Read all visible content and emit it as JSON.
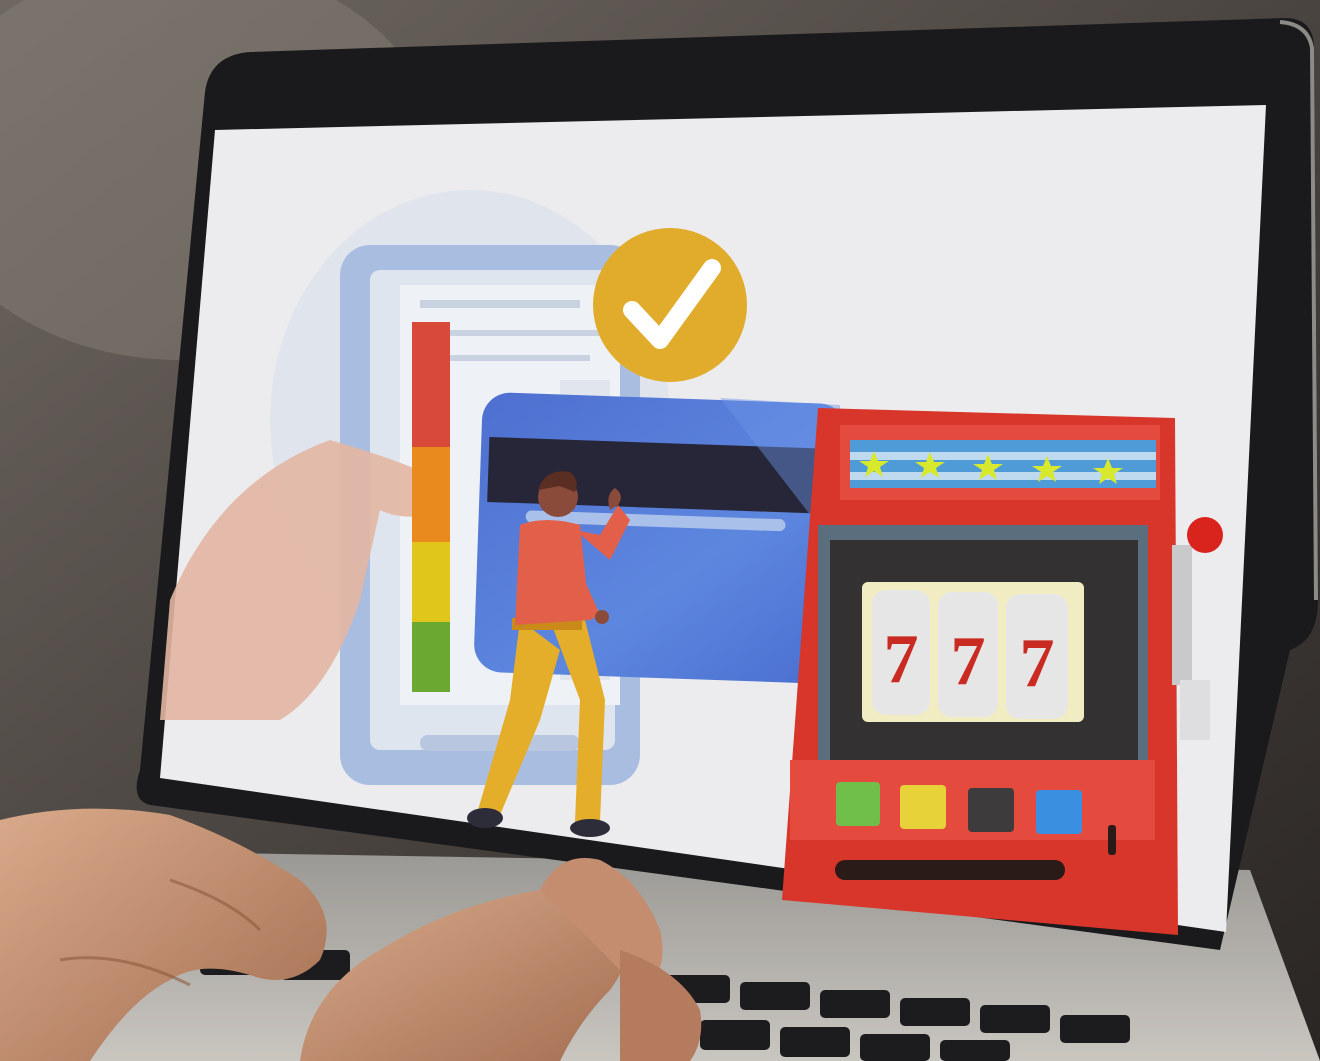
{
  "scene": {
    "colors": {
      "background_dark": "#3a3633",
      "laptop_bezel": "#1a1a1c",
      "screen_bg": "#ececee",
      "checkmark_badge": "#e1ac2c",
      "card_blue": "#4f76d4",
      "slot_red": "#d9362b",
      "person_shirt": "#e2604a",
      "person_pants": "#e5ae2a",
      "meter": [
        "#d9493a",
        "#e88a1e",
        "#e0c51a",
        "#6aa832"
      ],
      "slot_buttons": [
        "#6fbf4a",
        "#e8d23a",
        "#3d3b3c",
        "#3b8fe0"
      ]
    },
    "slot_machine": {
      "reels": [
        "7",
        "7",
        "7"
      ],
      "stars_count": 5
    },
    "icons": [
      "checkmark-icon",
      "star-icon",
      "credit-card-icon",
      "slot-machine-icon",
      "lever-icon"
    ]
  }
}
